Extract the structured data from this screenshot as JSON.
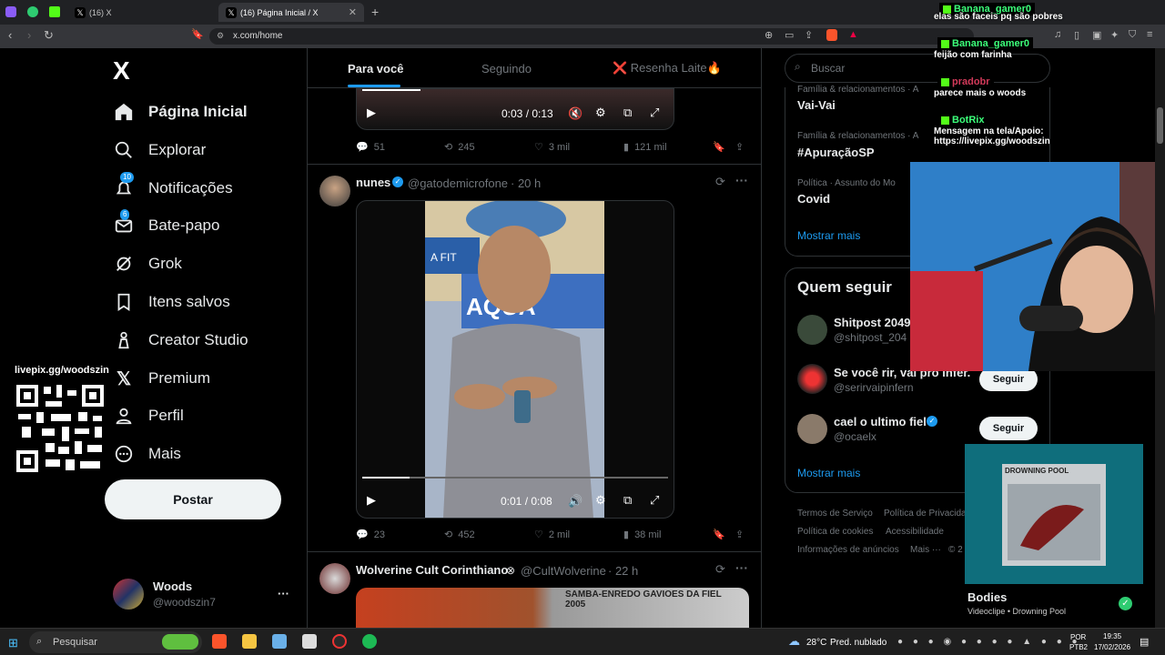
{
  "browser": {
    "tabs": [
      {
        "label": "(16) X"
      },
      {
        "label": "(16) Página Inicial / X"
      }
    ],
    "new_tab": "+",
    "url": "x.com/home"
  },
  "window_controls": {
    "minimize": "—",
    "maximize": "☐",
    "close": "✕"
  },
  "sidebar": {
    "logo": "X",
    "items": [
      {
        "label": "Página Inicial",
        "icon": "home-icon"
      },
      {
        "label": "Explorar",
        "icon": "search-icon"
      },
      {
        "label": "Notificações",
        "icon": "bell-icon",
        "badge": "10"
      },
      {
        "label": "Bate-papo",
        "icon": "mail-icon",
        "badge": "6"
      },
      {
        "label": "Grok",
        "icon": "grok-icon"
      },
      {
        "label": "Itens salvos",
        "icon": "bookmark-icon"
      },
      {
        "label": "Creator Studio",
        "icon": "creator-icon"
      },
      {
        "label": "Premium",
        "icon": "x-premium-icon"
      },
      {
        "label": "Perfil",
        "icon": "person-icon"
      },
      {
        "label": "Mais",
        "icon": "more-circle-icon"
      }
    ],
    "post_label": "Postar",
    "account": {
      "name": "Woods",
      "handle": "@woodszin7",
      "more": "···"
    }
  },
  "stream_overlay": {
    "livepix": "livepix.gg/woodszin",
    "chat": [
      {
        "user": "Banana_gamer0",
        "msg": "elas são faceis pq são pobres"
      },
      {
        "user": "Banana_gamer0",
        "msg": "feijão com farinha"
      },
      {
        "user": "pradobr",
        "msg": "parece mais o woods"
      },
      {
        "user": "BotRix",
        "msg": "Mensagem na tela/Apoio: https://livepix.gg/woodszin"
      }
    ],
    "music": {
      "title": "Bodies",
      "subtitle": "Videoclipe • Drowning Pool",
      "album_text": "DROWNING POOL"
    }
  },
  "feed": {
    "tabs": [
      "Para você",
      "Seguindo",
      "❌ Resenha Laite🔥"
    ],
    "post1": {
      "time": "0:03 / 0:13",
      "actions": {
        "replies": "51",
        "reposts": "245",
        "likes": "3 mil",
        "views": "121 mil"
      }
    },
    "post2": {
      "name": "nunes",
      "handle": "@gatodemicrofone",
      "age": "· 20 h",
      "time": "0:01 / 0:08",
      "actions": {
        "replies": "23",
        "reposts": "452",
        "likes": "2 mil",
        "views": "38 mil"
      }
    },
    "post3": {
      "name": "Wolverine Cult Corinthiano",
      "handle": "@CultWolverine",
      "age": "· 22 h",
      "sign_text": "SAMBA-ENREDO GAVIOES DA FIEL 2005"
    }
  },
  "right": {
    "search_placeholder": "Buscar",
    "trends": [
      {
        "category": "Família & relacionamentos · A",
        "name": "Vai-Vai"
      },
      {
        "category": "Família & relacionamentos · A",
        "name": "#ApuraçãoSP"
      },
      {
        "category": "Política · Assunto do Mo",
        "name": "Covid"
      }
    ],
    "show_more": "Mostrar mais",
    "who_to_follow_title": "Quem seguir",
    "who_to_follow": [
      {
        "name": "Shitpost 2049",
        "handle": "@shitpost_204"
      },
      {
        "name": "Se você rir, vai pro infer...",
        "handle": "@serirvaipinfern",
        "button": "Seguir"
      },
      {
        "name": "cael o ultimo fiel",
        "handle": "@ocaelx",
        "button": "Seguir"
      }
    ],
    "show_more2": "Mostrar mais",
    "footer": [
      "Termos de Serviço",
      "Política de Privacidade",
      "Política de cookies",
      "Acessibilidade",
      "Informações de anúncios",
      "Mais ···",
      "© 2"
    ]
  },
  "taskbar": {
    "search": "Pesquisar",
    "weather_temp": "28°C",
    "weather_text": "Pred. nublado",
    "lang1": "POR",
    "lang2": "PTB2",
    "time": "19:35",
    "date": "17/02/2026"
  }
}
